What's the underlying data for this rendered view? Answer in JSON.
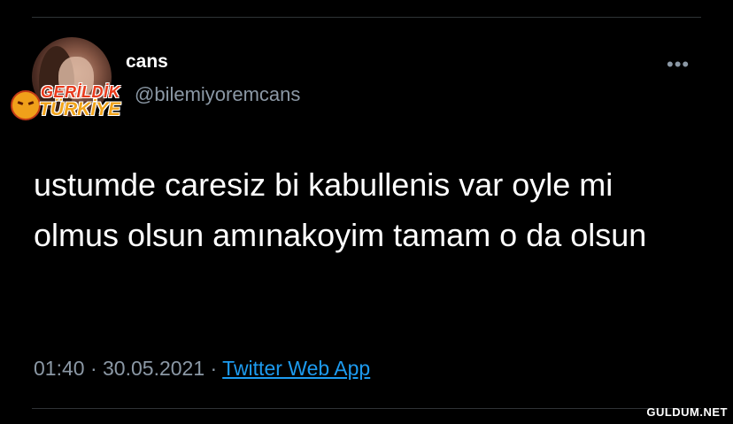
{
  "tweet": {
    "display_name": "cans",
    "handle": "@bilemiyoremcans",
    "more_icon": "•••",
    "text": "ustumde caresiz bi kabullenis var oyle mi olmus olsun amınakoyim tamam o da olsun",
    "time": "01:40",
    "separator": " · ",
    "date": "30.05.2021",
    "source": "Twitter Web App"
  },
  "watermark": {
    "logo_line1": "GERİLDİK",
    "logo_line2": "TÜRKİYE",
    "site": "GULDUM.NET"
  },
  "colors": {
    "background": "#000000",
    "text": "#ffffff",
    "secondary": "#8b98a5",
    "link": "#1d9bf0"
  }
}
